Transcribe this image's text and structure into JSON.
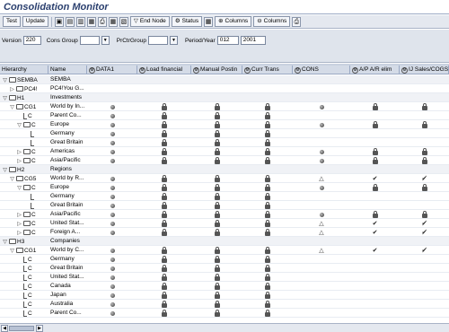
{
  "window": {
    "title": "Consolidation Monitor"
  },
  "toolbar": {
    "test_label": "Test",
    "update_label": "Update",
    "end_node_label": "End Node",
    "status_label": "Status",
    "columns1_label": "Columns",
    "columns2_label": "Columns"
  },
  "params": {
    "version_label": "Version",
    "version_value": "220",
    "cons_group_label": "Cons Group",
    "cons_group_value": "",
    "prctr_group_label": "PrCtrGroup",
    "prctr_group_value": "",
    "period_year_label": "Period/Year",
    "period_value": "012",
    "year_value": "2001"
  },
  "grid": {
    "headers": [
      "Hierarchy",
      "Name",
      "DATA1",
      "Load financial",
      "Manual Postin",
      "Curr Trans",
      "CONS",
      "A/P A/R elim",
      "IJ Sales/COGS"
    ],
    "rows": [
      {
        "level": 0,
        "exp": "▽",
        "kind": "folder",
        "code": "SEMBA",
        "name": "SEMBA",
        "grp": true,
        "m": [
          "",
          "",
          "",
          "",
          "",
          "",
          ""
        ]
      },
      {
        "level": 1,
        "exp": "▷",
        "kind": "folder",
        "code": "PC4!",
        "name": "PC4!You G...",
        "grp": false,
        "m": [
          "",
          "",
          "",
          "",
          "",
          "",
          ""
        ]
      },
      {
        "level": 0,
        "exp": "▽",
        "kind": "folder",
        "code": "H1",
        "name": "Investments",
        "grp": true,
        "m": [
          "",
          "",
          "",
          "",
          "",
          "",
          ""
        ]
      },
      {
        "level": 1,
        "exp": "▽",
        "kind": "folder",
        "code": "CG1",
        "name": "World by In...",
        "grp": false,
        "m": [
          "dot",
          "lock",
          "lock",
          "lock",
          "dot",
          "lock",
          "lock"
        ]
      },
      {
        "level": 2,
        "exp": "",
        "kind": "leaf",
        "code": "C",
        "name": "Parent Co...",
        "grp": false,
        "m": [
          "dot",
          "lock",
          "lock",
          "lock",
          "",
          "",
          ""
        ]
      },
      {
        "level": 2,
        "exp": "▽",
        "kind": "folder",
        "code": "C",
        "name": "Europe",
        "grp": false,
        "m": [
          "dot",
          "lock",
          "lock",
          "lock",
          "dot",
          "lock",
          "lock"
        ]
      },
      {
        "level": 3,
        "exp": "",
        "kind": "leaf",
        "code": "",
        "name": "Germany",
        "grp": false,
        "m": [
          "dot",
          "lock",
          "lock",
          "lock",
          "",
          "",
          ""
        ]
      },
      {
        "level": 3,
        "exp": "",
        "kind": "leaf",
        "code": "",
        "name": "Great Britain",
        "grp": false,
        "m": [
          "dot",
          "lock",
          "lock",
          "lock",
          "",
          "",
          ""
        ]
      },
      {
        "level": 2,
        "exp": "▷",
        "kind": "folder",
        "code": "C",
        "name": "Americas",
        "grp": false,
        "m": [
          "dot",
          "lock",
          "lock",
          "lock",
          "dot",
          "lock",
          "lock"
        ]
      },
      {
        "level": 2,
        "exp": "▷",
        "kind": "folder",
        "code": "C",
        "name": "Asia/Pacific",
        "grp": false,
        "m": [
          "dot",
          "lock",
          "lock",
          "lock",
          "dot",
          "lock",
          "lock"
        ]
      },
      {
        "level": 0,
        "exp": "▽",
        "kind": "folder",
        "code": "H2",
        "name": "Regions",
        "grp": true,
        "m": [
          "",
          "",
          "",
          "",
          "",
          "",
          ""
        ]
      },
      {
        "level": 1,
        "exp": "▽",
        "kind": "folder",
        "code": "CG5",
        "name": "World by R...",
        "grp": false,
        "m": [
          "dot",
          "lock",
          "lock",
          "lock",
          "tri",
          "chk",
          "dchk"
        ]
      },
      {
        "level": 2,
        "exp": "▽",
        "kind": "folder",
        "code": "C",
        "name": "Europe",
        "grp": false,
        "m": [
          "dot",
          "lock",
          "lock",
          "lock",
          "dot",
          "lock",
          "lock"
        ]
      },
      {
        "level": 3,
        "exp": "",
        "kind": "leaf",
        "code": "",
        "name": "Germany",
        "grp": false,
        "m": [
          "dot",
          "lock",
          "lock",
          "lock",
          "",
          "",
          ""
        ]
      },
      {
        "level": 3,
        "exp": "",
        "kind": "leaf",
        "code": "",
        "name": "Great Britain",
        "grp": false,
        "m": [
          "dot",
          "lock",
          "lock",
          "lock",
          "",
          "",
          ""
        ]
      },
      {
        "level": 2,
        "exp": "▷",
        "kind": "folder",
        "code": "C",
        "name": "Asia/Pacific",
        "grp": false,
        "m": [
          "dot",
          "lock",
          "lock",
          "lock",
          "dot",
          "lock",
          "lock"
        ]
      },
      {
        "level": 2,
        "exp": "▷",
        "kind": "folder",
        "code": "C",
        "name": "United Stat...",
        "grp": false,
        "m": [
          "dot",
          "lock",
          "lock",
          "lock",
          "tri",
          "chk",
          "dchk"
        ]
      },
      {
        "level": 2,
        "exp": "▷",
        "kind": "folder",
        "code": "C",
        "name": "Foreign A...",
        "grp": false,
        "m": [
          "dot",
          "lock",
          "lock",
          "lock",
          "tri",
          "chk",
          "dchk"
        ]
      },
      {
        "level": 0,
        "exp": "▽",
        "kind": "folder",
        "code": "H3",
        "name": "Companies",
        "grp": true,
        "m": [
          "",
          "",
          "",
          "",
          "",
          "",
          ""
        ]
      },
      {
        "level": 1,
        "exp": "▽",
        "kind": "folder",
        "code": "CG1",
        "name": "World by C...",
        "grp": false,
        "m": [
          "dot",
          "lock",
          "lock",
          "lock",
          "tri",
          "chk",
          "dchk"
        ]
      },
      {
        "level": 2,
        "exp": "",
        "kind": "leaf",
        "code": "C",
        "name": "Germany",
        "grp": false,
        "m": [
          "dot",
          "lock",
          "lock",
          "lock",
          "",
          "",
          ""
        ]
      },
      {
        "level": 2,
        "exp": "",
        "kind": "leaf",
        "code": "C",
        "name": "Great Britain",
        "grp": false,
        "m": [
          "dot",
          "lock",
          "lock",
          "lock",
          "",
          "",
          ""
        ]
      },
      {
        "level": 2,
        "exp": "",
        "kind": "leaf",
        "code": "C",
        "name": "United Stat...",
        "grp": false,
        "m": [
          "dot",
          "lock",
          "lock",
          "lock",
          "",
          "",
          ""
        ]
      },
      {
        "level": 2,
        "exp": "",
        "kind": "leaf",
        "code": "C",
        "name": "Canada",
        "grp": false,
        "m": [
          "dot",
          "lock",
          "lock",
          "lock",
          "",
          "",
          ""
        ]
      },
      {
        "level": 2,
        "exp": "",
        "kind": "leaf",
        "code": "C",
        "name": "Japan",
        "grp": false,
        "m": [
          "dot",
          "lock",
          "lock",
          "lock",
          "",
          "",
          ""
        ]
      },
      {
        "level": 2,
        "exp": "",
        "kind": "leaf",
        "code": "C",
        "name": "Australia",
        "grp": false,
        "m": [
          "dot",
          "lock",
          "lock",
          "lock",
          "",
          "",
          ""
        ]
      },
      {
        "level": 2,
        "exp": "",
        "kind": "leaf",
        "code": "C",
        "name": "Parent Co...",
        "grp": false,
        "m": [
          "dot",
          "lock",
          "lock",
          "lock",
          "",
          "",
          ""
        ]
      }
    ]
  }
}
